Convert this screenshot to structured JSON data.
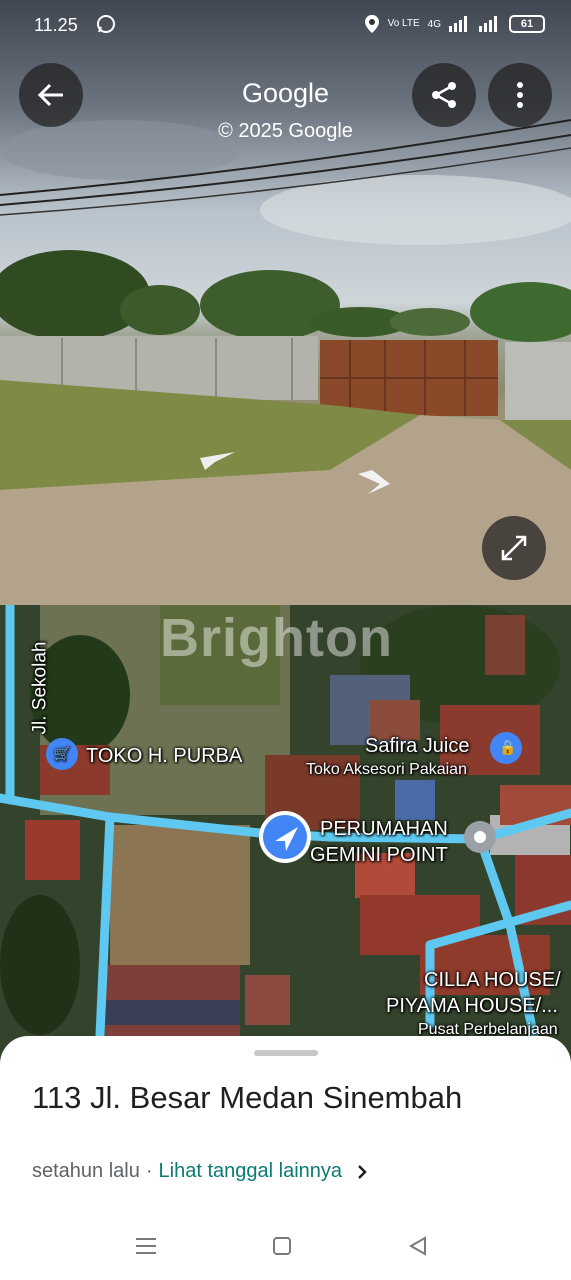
{
  "status_bar": {
    "time": "11.25",
    "network": "Vo LTE",
    "network_type": "4G",
    "battery": "61"
  },
  "street_view": {
    "title": "Google",
    "copyright": "© 2025 Google",
    "icons": [
      "back-arrow-icon",
      "share-icon",
      "more-vert-icon",
      "expand-icon"
    ]
  },
  "map": {
    "watermark": "Brighton",
    "street_label": "Jl. Sekolah",
    "places": {
      "toko_purba": "TOKO H. PURBA",
      "safira": "Safira Juice",
      "toko_aksesori": "Toko Aksesori Pakaian",
      "perumahan_1": "PERUMAHAN",
      "perumahan_2": "GEMINI POINT",
      "cilla_1": "CILLA HOUSE/",
      "cilla_2": "PIYAMA HOUSE/...",
      "pusat": "Pusat Perbelanjaan"
    },
    "colors": {
      "road": "#5ec8f0",
      "location_pin": "#4285f4"
    }
  },
  "sheet": {
    "address": "113 Jl. Besar Medan Sinembah",
    "date_text": "setahun lalu",
    "separator": "·",
    "link_text": "Lihat tanggal lainnya"
  },
  "nav_bar": {
    "icons": [
      "menu-icon",
      "home-square-icon",
      "back-triangle-icon"
    ]
  }
}
